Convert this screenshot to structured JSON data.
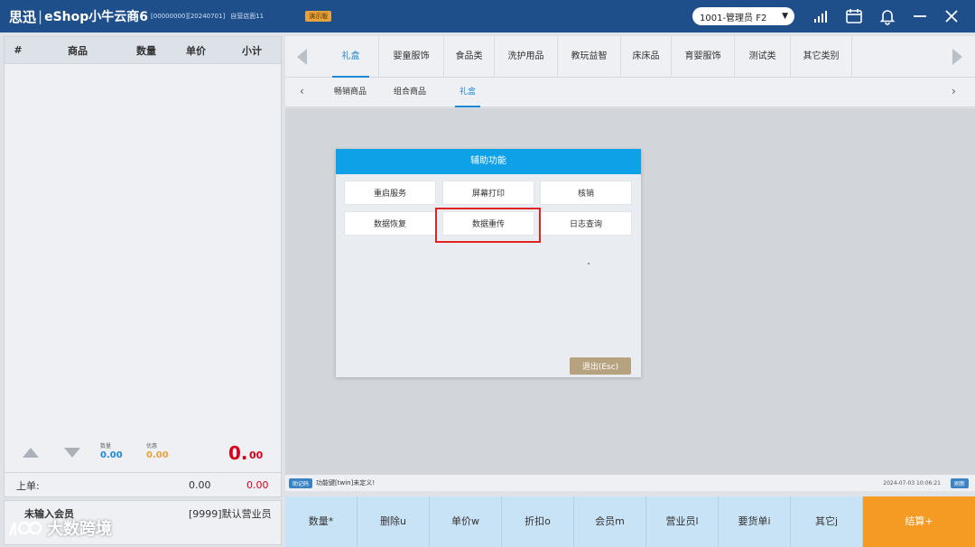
{
  "titlebar": {
    "brand": "思迅",
    "brand_sep": "|",
    "app_name": "eShop小牛云商6",
    "shop_code": "[00000000][20240701]",
    "shop_name": "自营店面11",
    "demo_badge": "演示版",
    "user": "1001-管理员 F2",
    "user_caret": "▼"
  },
  "cart": {
    "columns": [
      "#",
      "商品",
      "数量",
      "单价",
      "小计"
    ],
    "qty_label": "数量",
    "qty_value": "0.00",
    "discount_label": "优惠",
    "discount_value": "0.00",
    "total_int": "0.",
    "total_dec": "00",
    "prev_label": "上单:",
    "prev_qty": "0.00",
    "prev_total": "0.00"
  },
  "member": {
    "status": "未输入会员",
    "salesperson": "[9999]默认营业员"
  },
  "watermark": {
    "text": "大数跨境"
  },
  "categories": {
    "tabs": [
      "礼盒",
      "婴童服饰",
      "食品类",
      "洗护用品",
      "教玩益智",
      "床床品",
      "育婴服饰",
      "测试类",
      "其它类别"
    ],
    "active_index": 0
  },
  "subcategories": {
    "tabs": [
      "畅销商品",
      "组合商品",
      "礼盒"
    ],
    "active_index": 2,
    "prev": "‹",
    "next": "›"
  },
  "dialog": {
    "title": "辅助功能",
    "buttons": [
      "重启服务",
      "屏幕打印",
      "核销",
      "数据恢复",
      "数据重传",
      "日志查询"
    ],
    "exit": "退出(Esc)"
  },
  "status": {
    "help_badge": "助记码",
    "message": "功能键[twin]未定义!",
    "time": "2024-07-03 10:06:21",
    "badge": "刷新"
  },
  "functions": {
    "buttons": [
      "数量*",
      "删除u",
      "单价w",
      "折扣o",
      "会员m",
      "营业员l",
      "要货单i",
      "其它j"
    ],
    "checkout": "结算+"
  },
  "colors": {
    "titlebar": "#1f4f8a",
    "accent": "#1e88d6",
    "dialog_header": "#0ea1e8",
    "highlight": "#e02424",
    "total": "#d9001b",
    "checkout": "#f59a23"
  }
}
